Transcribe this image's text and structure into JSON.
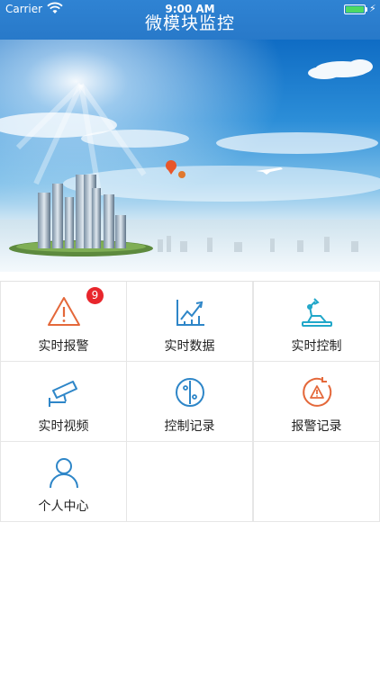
{
  "status_bar": {
    "carrier": "Carrier",
    "time": "9:00 AM"
  },
  "header": {
    "title": "微模块监控"
  },
  "colors": {
    "header": "#2f83d3",
    "icon_blue": "#2e86c8",
    "icon_orange": "#e4683a",
    "icon_cyan": "#21a7c9",
    "badge": "#e8262c"
  },
  "menu": [
    {
      "label": "实时报警",
      "icon": "warning-triangle-icon",
      "badge": "9"
    },
    {
      "label": "实时数据",
      "icon": "trend-chart-icon"
    },
    {
      "label": "实时控制",
      "icon": "robot-arm-icon"
    },
    {
      "label": "实时视频",
      "icon": "cctv-camera-icon"
    },
    {
      "label": "控制记录",
      "icon": "control-circle-icon"
    },
    {
      "label": "报警记录",
      "icon": "alarm-record-icon"
    },
    {
      "label": "个人中心",
      "icon": "user-icon"
    }
  ]
}
